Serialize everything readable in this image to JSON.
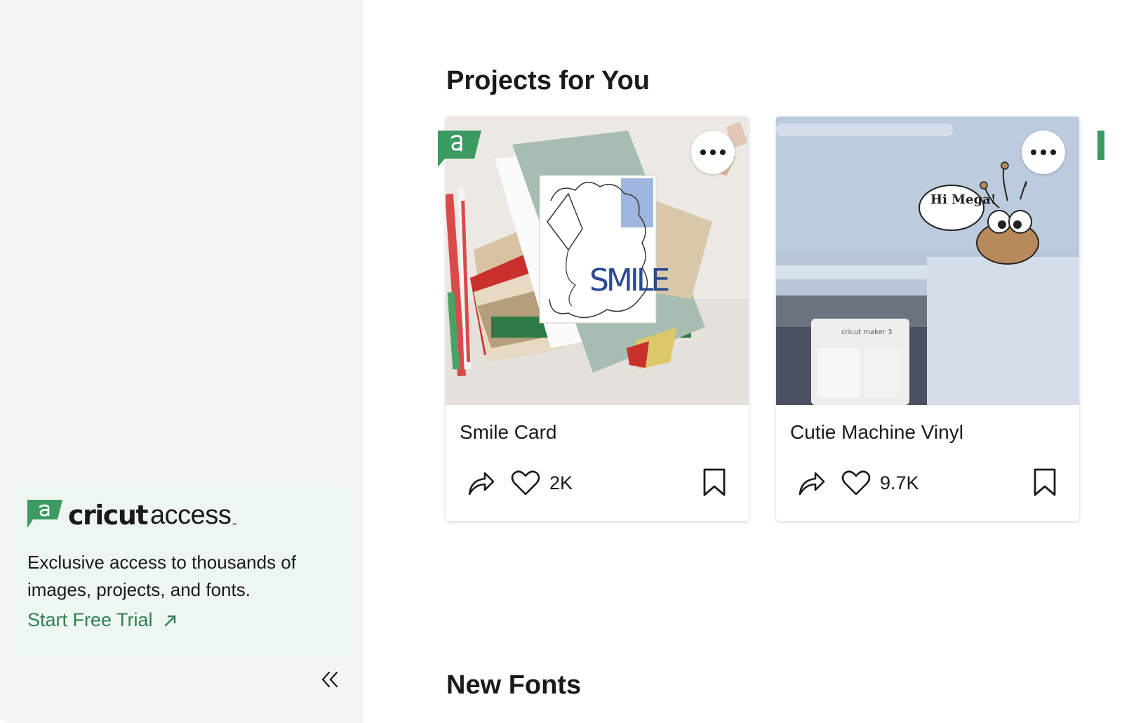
{
  "sidebar": {
    "access_card": {
      "brand": "cricut",
      "product": "access",
      "trademark": "™",
      "description": "Exclusive access to thousands of images, projects, and fonts.",
      "cta_label": "Start Free Trial"
    },
    "collapse_icon": "double-chevron-left-icon"
  },
  "main": {
    "projects_section": {
      "title": "Projects for You",
      "cards": [
        {
          "title": "Smile Card",
          "likes": "2K",
          "access_badge": true,
          "image_text": "SMILE"
        },
        {
          "title": "Cutie Machine Vinyl",
          "likes": "9.7K",
          "access_badge": false,
          "image_text": "Hi Mega!",
          "machine_label": "cricut maker 3"
        }
      ]
    },
    "fonts_section": {
      "title": "New Fonts"
    }
  },
  "colors": {
    "accent_green": "#2e8052",
    "badge_green": "#3a9a62",
    "sidebar_bg": "#f4f4f4",
    "access_card_bg": "#eef6f1"
  }
}
